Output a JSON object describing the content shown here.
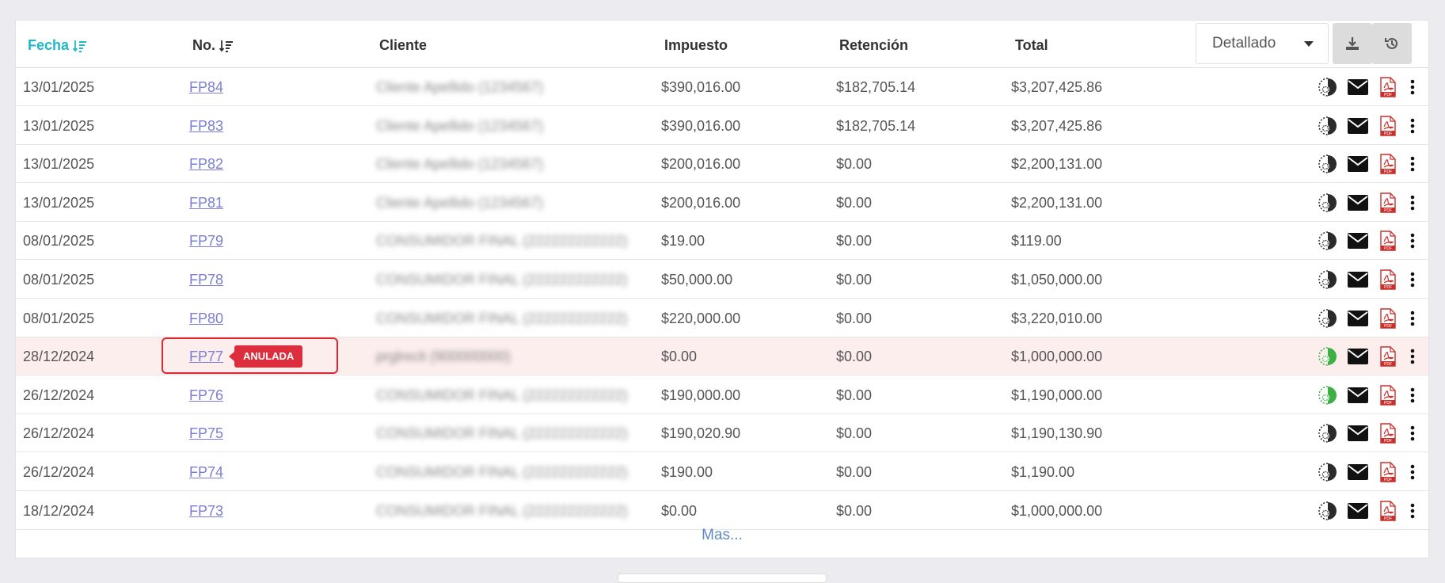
{
  "table": {
    "headers": {
      "fecha": "Fecha",
      "no": "No.",
      "cliente": "Cliente",
      "impuesto": "Impuesto",
      "retencion": "Retención",
      "total": "Total"
    },
    "view_select": "Detallado",
    "rows": [
      {
        "fecha": "13/01/2025",
        "no": "FP84",
        "cliente": "Cliente Apellido (1234567)",
        "impuesto": "$390,016.00",
        "retencion": "$182,705.14",
        "total": "$3,207,425.86",
        "status_color": "#2b2b2b"
      },
      {
        "fecha": "13/01/2025",
        "no": "FP83",
        "cliente": "Cliente Apellido (1234567)",
        "impuesto": "$390,016.00",
        "retencion": "$182,705.14",
        "total": "$3,207,425.86",
        "status_color": "#2b2b2b"
      },
      {
        "fecha": "13/01/2025",
        "no": "FP82",
        "cliente": "Cliente Apellido (1234567)",
        "impuesto": "$200,016.00",
        "retencion": "$0.00",
        "total": "$2,200,131.00",
        "status_color": "#2b2b2b"
      },
      {
        "fecha": "13/01/2025",
        "no": "FP81",
        "cliente": "Cliente Apellido (1234567)",
        "impuesto": "$200,016.00",
        "retencion": "$0.00",
        "total": "$2,200,131.00",
        "status_color": "#2b2b2b"
      },
      {
        "fecha": "08/01/2025",
        "no": "FP79",
        "cliente": "CONSUMIDOR FINAL (222222222222)",
        "impuesto": "$19.00",
        "retencion": "$0.00",
        "total": "$119.00",
        "status_color": "#2b2b2b"
      },
      {
        "fecha": "08/01/2025",
        "no": "FP78",
        "cliente": "CONSUMIDOR FINAL (222222222222)",
        "impuesto": "$50,000.00",
        "retencion": "$0.00",
        "total": "$1,050,000.00",
        "status_color": "#2b2b2b"
      },
      {
        "fecha": "08/01/2025",
        "no": "FP80",
        "cliente": "CONSUMIDOR FINAL (222222222222)",
        "impuesto": "$220,000.00",
        "retencion": "$0.00",
        "total": "$3,220,010.00",
        "status_color": "#2b2b2b"
      },
      {
        "fecha": "28/12/2024",
        "no": "FP77",
        "cliente": "prglrecli (900000000)",
        "impuesto": "$0.00",
        "retencion": "$0.00",
        "total": "$1,000,000.00",
        "status_color": "#3cb043",
        "badge": "ANULADA",
        "annulled": true
      },
      {
        "fecha": "26/12/2024",
        "no": "FP76",
        "cliente": "CONSUMIDOR FINAL (222222222222)",
        "impuesto": "$190,000.00",
        "retencion": "$0.00",
        "total": "$1,190,000.00",
        "status_color": "#3cb043"
      },
      {
        "fecha": "26/12/2024",
        "no": "FP75",
        "cliente": "CONSUMIDOR FINAL (222222222222)",
        "impuesto": "$190,020.90",
        "retencion": "$0.00",
        "total": "$1,190,130.90",
        "status_color": "#2b2b2b"
      },
      {
        "fecha": "26/12/2024",
        "no": "FP74",
        "cliente": "CONSUMIDOR FINAL (222222222222)",
        "impuesto": "$190.00",
        "retencion": "$0.00",
        "total": "$1,190.00",
        "status_color": "#2b2b2b"
      },
      {
        "fecha": "18/12/2024",
        "no": "FP73",
        "cliente": "CONSUMIDOR FINAL (222222222222)",
        "impuesto": "$0.00",
        "retencion": "$0.00",
        "total": "$1,000,000.00",
        "status_color": "#2b2b2b"
      }
    ],
    "more_label": "Mas..."
  },
  "icons": {
    "status": "dian-status-icon",
    "email": "email-icon",
    "pdf": "pdf-icon",
    "more": "more-vertical-icon",
    "download": "download-icon",
    "history": "history-icon"
  },
  "colors": {
    "accent": "#1fb8c9",
    "link": "#7b7ed6",
    "badge": "#dc2e3c",
    "annulled_row": "#fdeeee"
  }
}
